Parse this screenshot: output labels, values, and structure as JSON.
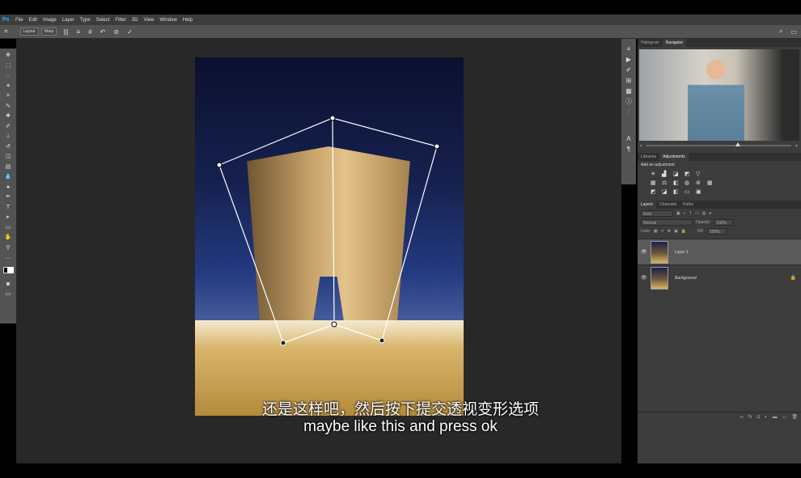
{
  "app": {
    "logo": "Ps"
  },
  "menu": [
    "File",
    "Edit",
    "Image",
    "Layer",
    "Type",
    "Select",
    "Filter",
    "3D",
    "View",
    "Window",
    "Help"
  ],
  "options": {
    "layout_label": "Layout",
    "warp_label": "Warp"
  },
  "tools": [
    "move",
    "marquee",
    "lasso",
    "magic-wand",
    "crop",
    "eyedropper",
    "healing",
    "brush",
    "stamp",
    "history-brush",
    "eraser",
    "gradient",
    "blur",
    "dodge",
    "pen",
    "type",
    "path-select",
    "shape",
    "hand",
    "zoom",
    "more"
  ],
  "navigator": {
    "tabs": [
      "Histogram",
      "Navigator"
    ],
    "active": "Navigator"
  },
  "adjustments": {
    "tabs": [
      "Libraries",
      "Adjustments"
    ],
    "active": "Adjustments",
    "title": "Add an adjustment"
  },
  "layers": {
    "tabs": [
      "Layers",
      "Channels",
      "Paths"
    ],
    "active": "Layers",
    "filter_placeholder": "Kind",
    "blend_mode": "Normal",
    "opacity_label": "Opacity:",
    "opacity": "100%",
    "lock_label": "Lock:",
    "fill_label": "Fill:",
    "fill": "100%",
    "items": [
      {
        "name": "Layer 1",
        "selected": true
      },
      {
        "name": "Background",
        "locked": true
      }
    ]
  },
  "subtitles": {
    "chinese": "还是这样吧，然后按下提交透视变形选项",
    "english": "maybe like this and press ok"
  }
}
